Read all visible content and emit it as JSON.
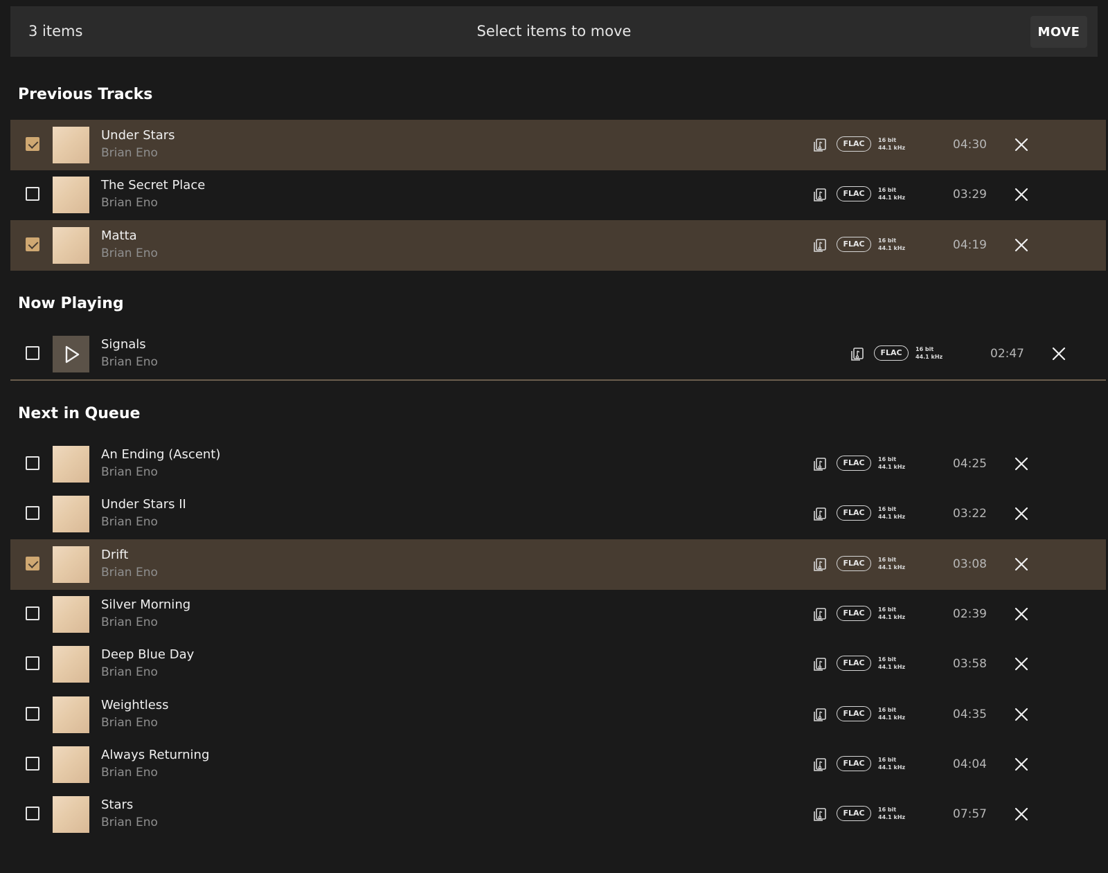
{
  "header": {
    "count_text": "3 items",
    "prompt": "Select items to move",
    "move_label": "MOVE"
  },
  "colors": {
    "background": "#1a1a1a",
    "header_bg": "#2b2b2b",
    "selected_row": "#473c31",
    "checkbox_accent": "#cfa872"
  },
  "sections": [
    {
      "title": "Previous Tracks"
    },
    {
      "title": "Now Playing"
    },
    {
      "title": "Next in Queue"
    }
  ],
  "tracks": [
    {
      "title": "Under Stars",
      "artist": "Brian Eno",
      "format": "FLAC",
      "bit": "16 bit",
      "rate": "44.1 kHz",
      "duration": "04:30",
      "selected": true,
      "section": 0
    },
    {
      "title": "The Secret Place",
      "artist": "Brian Eno",
      "format": "FLAC",
      "bit": "16 bit",
      "rate": "44.1 kHz",
      "duration": "03:29",
      "selected": false,
      "section": 0
    },
    {
      "title": "Matta",
      "artist": "Brian Eno",
      "format": "FLAC",
      "bit": "16 bit",
      "rate": "44.1 kHz",
      "duration": "04:19",
      "selected": true,
      "section": 0
    },
    {
      "title": "Signals",
      "artist": "Brian Eno",
      "format": "FLAC",
      "bit": "16 bit",
      "rate": "44.1 kHz",
      "duration": "02:47",
      "selected": false,
      "section": 1,
      "now_playing": true,
      "art_icon": "play-icon"
    },
    {
      "title": "An Ending (Ascent)",
      "artist": "Brian Eno",
      "format": "FLAC",
      "bit": "16 bit",
      "rate": "44.1 kHz",
      "duration": "04:25",
      "selected": false,
      "section": 2
    },
    {
      "title": "Under Stars II",
      "artist": "Brian Eno",
      "format": "FLAC",
      "bit": "16 bit",
      "rate": "44.1 kHz",
      "duration": "03:22",
      "selected": false,
      "section": 2
    },
    {
      "title": "Drift",
      "artist": "Brian Eno",
      "format": "FLAC",
      "bit": "16 bit",
      "rate": "44.1 kHz",
      "duration": "03:08",
      "selected": true,
      "section": 2
    },
    {
      "title": "Silver Morning",
      "artist": "Brian Eno",
      "format": "FLAC",
      "bit": "16 bit",
      "rate": "44.1 kHz",
      "duration": "02:39",
      "selected": false,
      "section": 2
    },
    {
      "title": "Deep Blue Day",
      "artist": "Brian Eno",
      "format": "FLAC",
      "bit": "16 bit",
      "rate": "44.1 kHz",
      "duration": "03:58",
      "selected": false,
      "section": 2
    },
    {
      "title": "Weightless",
      "artist": "Brian Eno",
      "format": "FLAC",
      "bit": "16 bit",
      "rate": "44.1 kHz",
      "duration": "04:35",
      "selected": false,
      "section": 2
    },
    {
      "title": "Always Returning",
      "artist": "Brian Eno",
      "format": "FLAC",
      "bit": "16 bit",
      "rate": "44.1 kHz",
      "duration": "04:04",
      "selected": false,
      "section": 2
    },
    {
      "title": "Stars",
      "artist": "Brian Eno",
      "format": "FLAC",
      "bit": "16 bit",
      "rate": "44.1 kHz",
      "duration": "07:57",
      "selected": false,
      "section": 2
    }
  ]
}
